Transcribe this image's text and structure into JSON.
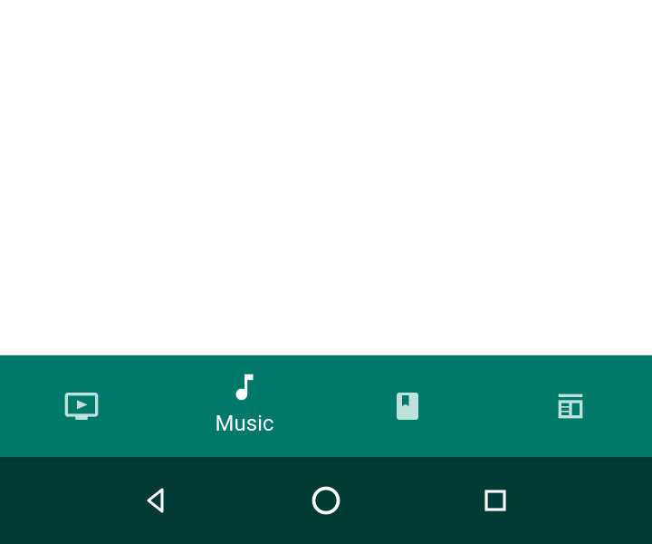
{
  "tabs": {
    "videos": {
      "label": "Movies & TV"
    },
    "music": {
      "label": "Music"
    },
    "books": {
      "label": "Books"
    },
    "news": {
      "label": "Newsstand"
    }
  },
  "active_tab": "music",
  "colors": {
    "tab_bar": "#00796b",
    "system_nav": "#003c35",
    "icon_inactive": "#bfe1db",
    "icon_active": "#ffffff"
  }
}
